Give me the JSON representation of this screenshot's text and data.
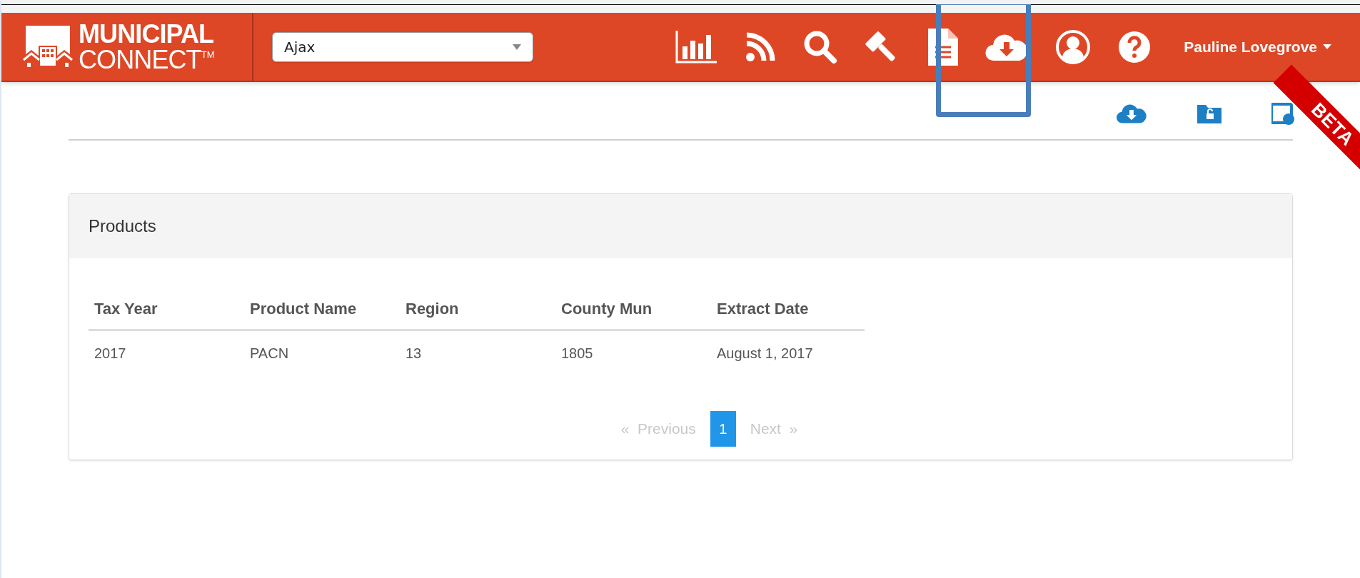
{
  "logo": {
    "line_1": "MUNICIPAL",
    "line_2": "CONNECT",
    "trademark": "TM"
  },
  "municipality_select": {
    "value": "Ajax"
  },
  "user_menu": {
    "name": "Pauline Lovegrove"
  },
  "ribbon": {
    "text": "BETA"
  },
  "panel": {
    "title": "Products",
    "table": {
      "columns": [
        "Tax Year",
        "Product Name",
        "Region",
        "County Mun",
        "Extract Date"
      ],
      "rows": [
        [
          "2017",
          "PACN",
          "13",
          "1805",
          "August 1, 2017"
        ]
      ]
    },
    "pagination": {
      "previous": {
        "label": "«  Previous",
        "disabled": true
      },
      "pages": [
        {
          "label": "1",
          "selected": true
        }
      ],
      "next": {
        "label": "Next  »",
        "disabled": true
      }
    }
  }
}
